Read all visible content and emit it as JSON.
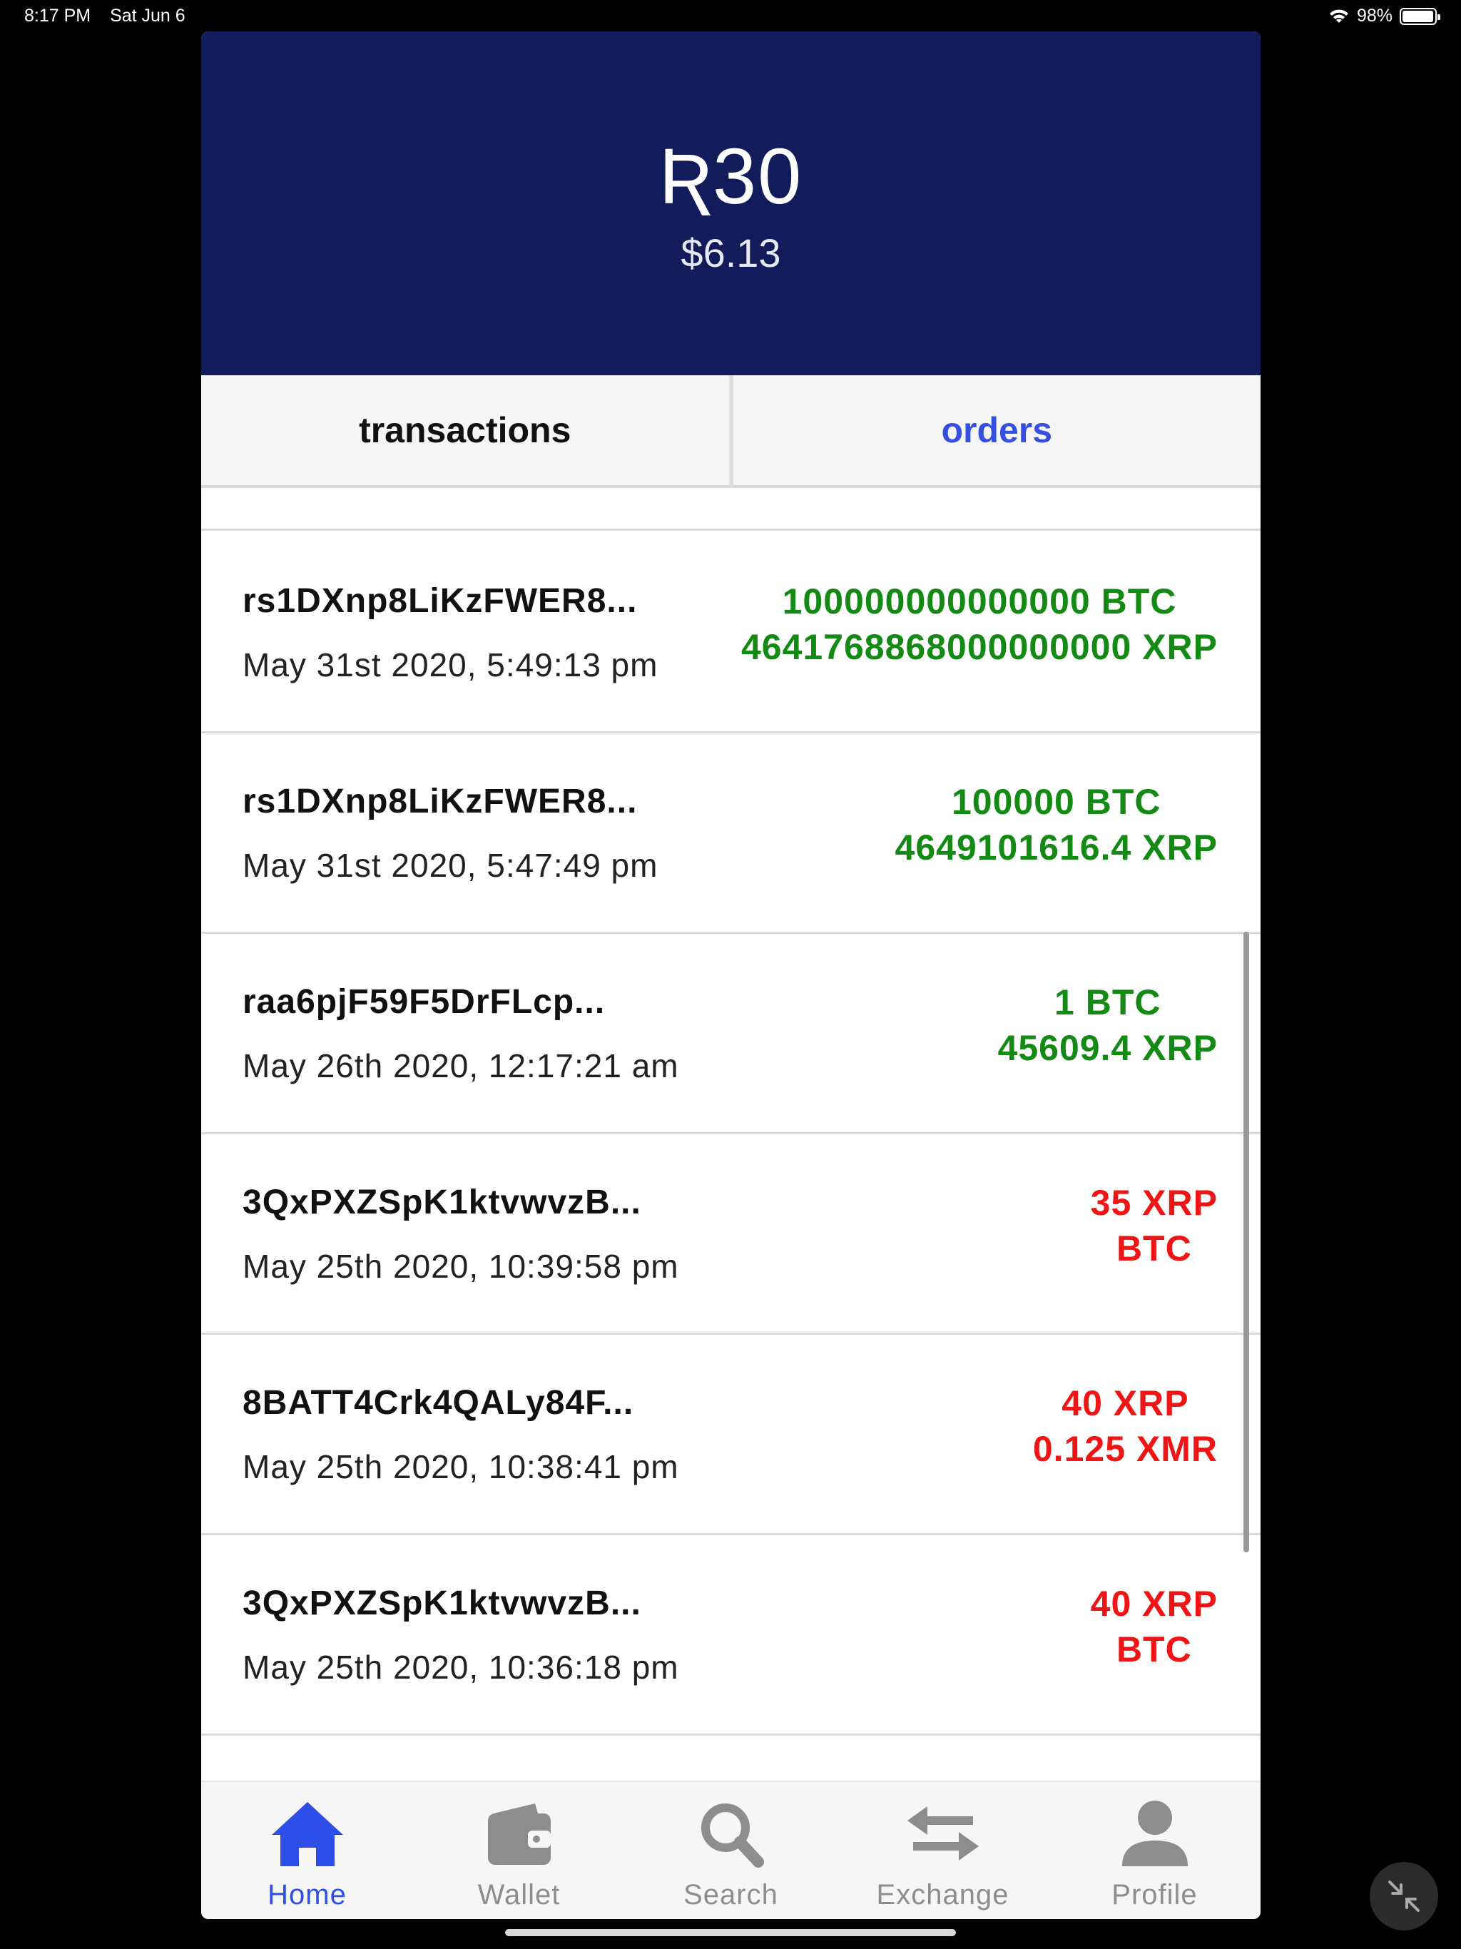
{
  "status_bar": {
    "time": "8:17 PM",
    "date": "Sat Jun 6",
    "battery": "98%",
    "battery_level": 0.98
  },
  "header": {
    "balance": "Ʀ30",
    "balance_usd": "$6.13"
  },
  "tabs": [
    {
      "label": "transactions",
      "active": false
    },
    {
      "label": "orders",
      "active": true
    }
  ],
  "transactions": [
    {
      "address": "rs1DXnp8LiKzFWER8...",
      "date": "May 31st 2020, 5:49:13 pm",
      "amount1": "100000000000000 BTC",
      "amount2": "4641768868000000000 XRP",
      "color": "#138a13"
    },
    {
      "address": "rs1DXnp8LiKzFWER8...",
      "date": "May 31st 2020, 5:47:49 pm",
      "amount1": "100000 BTC",
      "amount2": "4649101616.4 XRP",
      "color": "#138a13"
    },
    {
      "address": "raa6pjF59F5DrFLcp...",
      "date": "May 26th 2020, 12:17:21 am",
      "amount1": "1 BTC",
      "amount2": "45609.4 XRP",
      "color": "#138a13"
    },
    {
      "address": "3QxPXZSpK1ktvwvzB...",
      "date": "May 25th 2020, 10:39:58 pm",
      "amount1": "35 XRP",
      "amount2": "BTC",
      "color": "#f01414"
    },
    {
      "address": "8BATT4Crk4QALy84F...",
      "date": "May 25th 2020, 10:38:41 pm",
      "amount1": "40 XRP",
      "amount2": "0.125 XMR",
      "color": "#f01414"
    },
    {
      "address": "3QxPXZSpK1ktvwvzB...",
      "date": "May 25th 2020, 10:36:18 pm",
      "amount1": "40 XRP",
      "amount2": "BTC",
      "color": "#f01414"
    }
  ],
  "tabbar": [
    {
      "label": "Home",
      "icon": "home-icon",
      "active": true
    },
    {
      "label": "Wallet",
      "icon": "wallet-icon",
      "active": false
    },
    {
      "label": "Search",
      "icon": "search-icon",
      "active": false
    },
    {
      "label": "Exchange",
      "icon": "exchange-icon",
      "active": false
    },
    {
      "label": "Profile",
      "icon": "profile-icon",
      "active": false
    }
  ],
  "colors": {
    "header_bg": "#121c5b",
    "accent": "#2d4fe8",
    "incoming": "#138a13",
    "outgoing": "#f01414"
  }
}
